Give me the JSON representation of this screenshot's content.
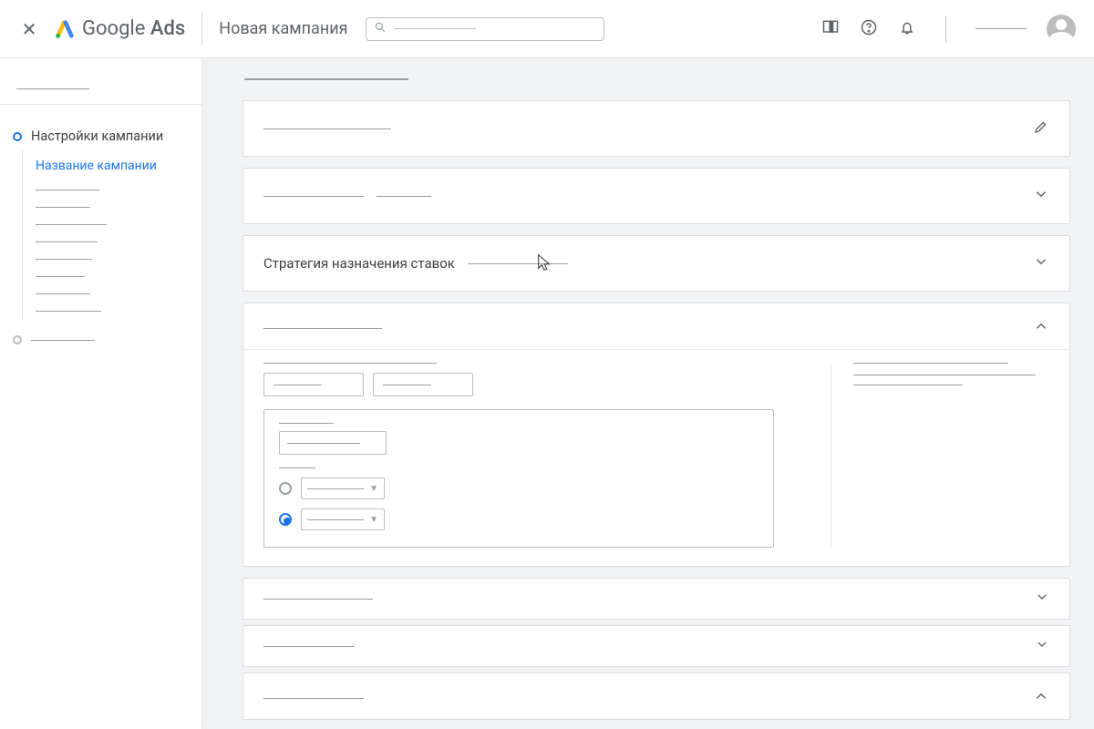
{
  "header": {
    "brand_a": "Google",
    "brand_b": "Ads",
    "page_title": "Новая кампания"
  },
  "sidebar": {
    "step_active": "Настройки кампании",
    "children": {
      "active": "Название кампании"
    }
  },
  "cards": {
    "bidding_label": "Стратегия назначения ставок"
  }
}
